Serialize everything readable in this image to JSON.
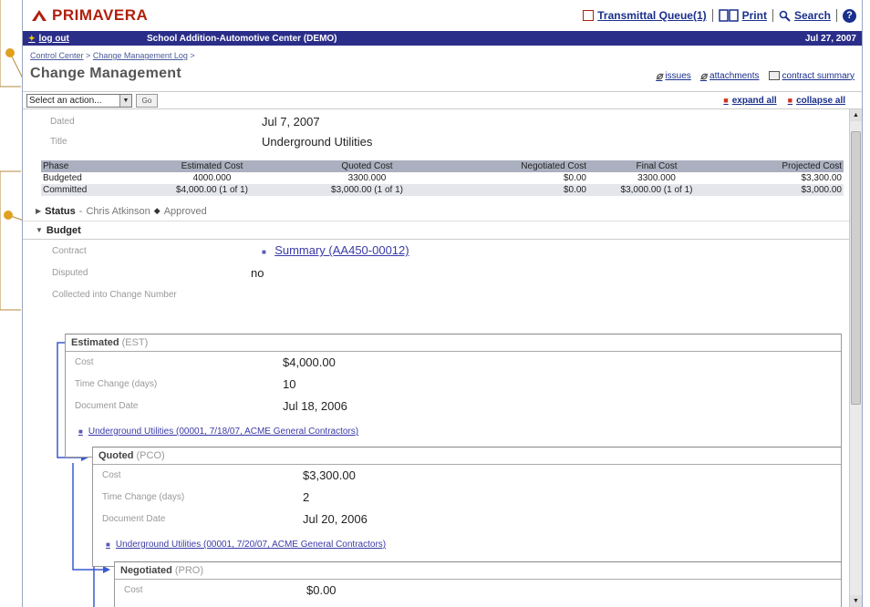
{
  "app": {
    "brand": "PRIMAVERA",
    "top_links": {
      "transmittal": "Transmittal Queue(1)",
      "print": "Print",
      "search": "Search",
      "help": "?"
    }
  },
  "nav": {
    "logout": "log out",
    "project": "School Addition-Automotive Center (DEMO)",
    "date": "Jul 27, 2007"
  },
  "page": {
    "breadcrumb": [
      "Control Center",
      "Change Management Log"
    ],
    "breadcrumb_sep": ">",
    "title": "Change Management",
    "links": {
      "issues": "issues",
      "attachments": "attachments",
      "contract_summary": "contract summary"
    }
  },
  "actions": {
    "select_placeholder": "Select an action...",
    "go": "Go",
    "expand_all": "expand all",
    "collapse_all": "collapse all"
  },
  "header_fields": {
    "dated_label": "Dated",
    "dated_value": "Jul 7, 2007",
    "title_label": "Title",
    "title_value": "Underground Utilities"
  },
  "cost_table": {
    "columns": [
      "Phase",
      "Estimated Cost",
      "Quoted Cost",
      "Negotiated Cost",
      "Final Cost",
      "Projected Cost"
    ],
    "rows": [
      [
        "Budgeted",
        "4000.000",
        "3300.000",
        "$0.00",
        "3300.000",
        "$3,300.00"
      ],
      [
        "Committed",
        "$4,000.00 (1 of 1)",
        "$3,000.00 (1 of 1)",
        "$0.00",
        "$3,000.00 (1 of 1)",
        "$3,000.00"
      ]
    ]
  },
  "status": {
    "label": "Status",
    "dash": "-",
    "person": "Chris Atkinson",
    "state": "Approved"
  },
  "budget": {
    "label": "Budget",
    "contract_label": "Contract",
    "contract_link": "Summary (AA450-00012)",
    "disputed_label": "Disputed",
    "disputed_value": "no",
    "collected_label": "Collected into Change Number"
  },
  "estimated": {
    "title": "Estimated",
    "abbr": "(EST)",
    "cost_label": "Cost",
    "cost_value": "$4,000.00",
    "time_label": "Time Change (days)",
    "time_value": "10",
    "date_label": "Document Date",
    "date_value": "Jul 18, 2006",
    "link": "Underground Utilities (00001, 7/18/07, ACME General Contractors)"
  },
  "quoted": {
    "title": "Quoted",
    "abbr": "(PCO)",
    "cost_label": "Cost",
    "cost_value": "$3,300.00",
    "time_label": "Time Change (days)",
    "time_value": "2",
    "date_label": "Document Date",
    "date_value": "Jul 20, 2006",
    "link": "Underground Utilities (00001, 7/20/07, ACME General Contractors)"
  },
  "negotiated": {
    "title": "Negotiated",
    "abbr": "(PRO)",
    "cost_label": "Cost",
    "cost_value": "$0.00"
  },
  "colors": {
    "brand_red": "#b0200e",
    "nav_blue": "#2b2e88",
    "link_blue": "#1a2f8c",
    "callout_gold": "#e0a020"
  }
}
